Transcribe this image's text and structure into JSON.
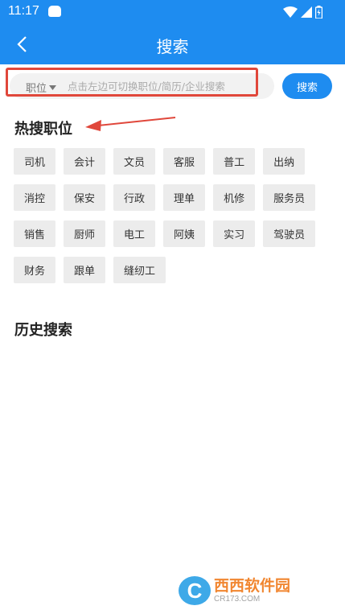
{
  "status_bar": {
    "time": "11:17"
  },
  "nav": {
    "title": "搜索"
  },
  "search": {
    "type_label": "职位",
    "placeholder": "点击左边可切换职位/简历/企业搜索",
    "button_label": "搜索"
  },
  "hot": {
    "title": "热搜职位",
    "rows": [
      [
        "司机",
        "会计",
        "文员",
        "客服",
        "普工",
        "出纳"
      ],
      [
        "消控",
        "保安",
        "行政",
        "理单",
        "机修",
        "服务员"
      ],
      [
        "销售",
        "厨师",
        "电工",
        "阿姨",
        "实习",
        "驾驶员"
      ],
      [
        "财务",
        "跟单",
        "缝纫工"
      ]
    ]
  },
  "history": {
    "title": "历史搜索"
  },
  "watermark": {
    "main": "西西软件园",
    "sub": "CR173.COM"
  },
  "colors": {
    "primary": "#1e8cf0",
    "highlight": "#e0473b",
    "tag_bg": "#ececec"
  }
}
